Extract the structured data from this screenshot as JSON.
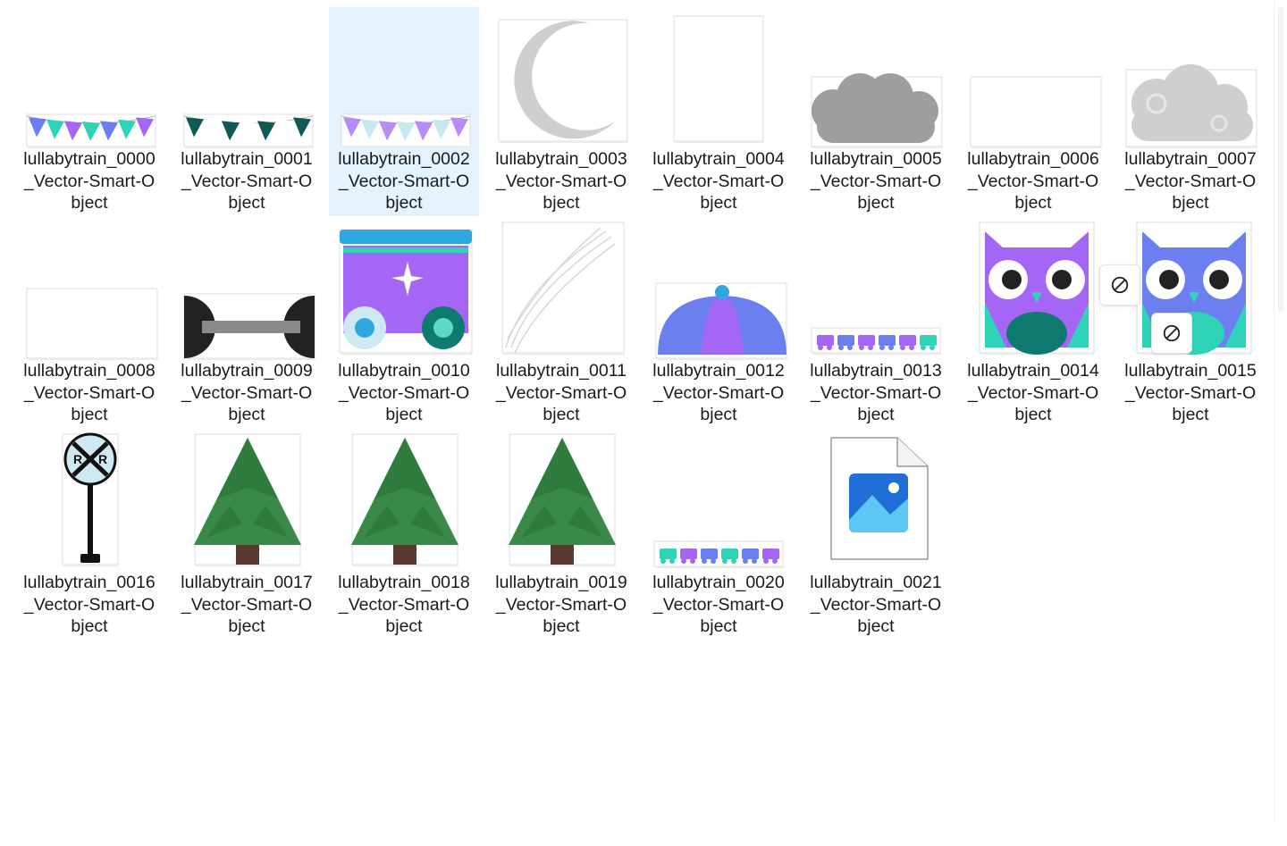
{
  "files": [
    {
      "name": "lullabytrain_0000_Vector-Smart-Object",
      "line1": "lullabytrain_0000",
      "line2": "_Vector-Smart-O",
      "line3": "bject",
      "thumb": "bunting-color-thumbnail",
      "selected": false
    },
    {
      "name": "lullabytrain_0001_Vector-Smart-Object",
      "line1": "lullabytrain_0001",
      "line2": "_Vector-Smart-O",
      "line3": "bject",
      "thumb": "bunting-dark-teal-thumbnail",
      "selected": false
    },
    {
      "name": "lullabytrain_0002_Vector-Smart-Object",
      "line1": "lullabytrain_0002",
      "line2": "_Vector-Smart-O",
      "line3": "bject",
      "thumb": "bunting-purple-thumbnail",
      "selected": true
    },
    {
      "name": "lullabytrain_0003_Vector-Smart-Object",
      "line1": "lullabytrain_0003",
      "line2": "_Vector-Smart-O",
      "line3": "bject",
      "thumb": "crescent-moon-thumbnail",
      "selected": false
    },
    {
      "name": "lullabytrain_0004_Vector-Smart-Object",
      "line1": "lullabytrain_0004",
      "line2": "_Vector-Smart-O",
      "line3": "bject",
      "thumb": "blank-portrait-thumbnail",
      "selected": false
    },
    {
      "name": "lullabytrain_0005_Vector-Smart-Object",
      "line1": "lullabytrain_0005",
      "line2": "_Vector-Smart-O",
      "line3": "bject",
      "thumb": "grey-cloud-thumbnail",
      "selected": false
    },
    {
      "name": "lullabytrain_0006_Vector-Smart-Object",
      "line1": "lullabytrain_0006",
      "line2": "_Vector-Smart-O",
      "line3": "bject",
      "thumb": "blank-landscape-thumbnail",
      "selected": false
    },
    {
      "name": "lullabytrain_0007_Vector-Smart-Object",
      "line1": "lullabytrain_0007",
      "line2": "_Vector-Smart-O",
      "line3": "bject",
      "thumb": "swirl-cloud-thumbnail",
      "selected": false
    },
    {
      "name": "lullabytrain_0008_Vector-Smart-Object",
      "line1": "lullabytrain_0008",
      "line2": "_Vector-Smart-O",
      "line3": "bject",
      "thumb": "blank-landscape-thumbnail",
      "selected": false
    },
    {
      "name": "lullabytrain_0009_Vector-Smart-Object",
      "line1": "lullabytrain_0009",
      "line2": "_Vector-Smart-O",
      "line3": "bject",
      "thumb": "axle-thumbnail",
      "selected": false
    },
    {
      "name": "lullabytrain_0010_Vector-Smart-Object",
      "line1": "lullabytrain_0010",
      "line2": "_Vector-Smart-O",
      "line3": "bject",
      "thumb": "train-car-thumbnail",
      "selected": false
    },
    {
      "name": "lullabytrain_0011_Vector-Smart-Object",
      "line1": "lullabytrain_0011",
      "line2": "_Vector-Smart-O",
      "line3": "bject",
      "thumb": "smoke-lines-thumbnail",
      "selected": false
    },
    {
      "name": "lullabytrain_0012_Vector-Smart-Object",
      "line1": "lullabytrain_0012",
      "line2": "_Vector-Smart-O",
      "line3": "bject",
      "thumb": "dome-thumbnail",
      "selected": false
    },
    {
      "name": "lullabytrain_0013_Vector-Smart-Object",
      "line1": "lullabytrain_0013",
      "line2": "_Vector-Smart-O",
      "line3": "bject",
      "thumb": "purple-train-thumbnail",
      "selected": false
    },
    {
      "name": "lullabytrain_0014_Vector-Smart-Object",
      "line1": "lullabytrain_0014",
      "line2": "_Vector-Smart-O",
      "line3": "bject",
      "thumb": "purple-owl-thumbnail",
      "selected": false
    },
    {
      "name": "lullabytrain_0015_Vector-Smart-Object",
      "line1": "lullabytrain_0015",
      "line2": "_Vector-Smart-O",
      "line3": "bject",
      "thumb": "blue-owl-thumbnail",
      "selected": false
    },
    {
      "name": "lullabytrain_0016_Vector-Smart-Object",
      "line1": "lullabytrain_0016",
      "line2": "_Vector-Smart-O",
      "line3": "bject",
      "thumb": "railroad-crossing-sign-thumbnail",
      "selected": false
    },
    {
      "name": "lullabytrain_0017_Vector-Smart-Object",
      "line1": "lullabytrain_0017",
      "line2": "_Vector-Smart-O",
      "line3": "bject",
      "thumb": "pine-tree-thumbnail",
      "selected": false
    },
    {
      "name": "lullabytrain_0018_Vector-Smart-Object",
      "line1": "lullabytrain_0018",
      "line2": "_Vector-Smart-O",
      "line3": "bject",
      "thumb": "pine-tree-thumbnail",
      "selected": false
    },
    {
      "name": "lullabytrain_0019_Vector-Smart-Object",
      "line1": "lullabytrain_0019",
      "line2": "_Vector-Smart-O",
      "line3": "bject",
      "thumb": "pine-tree-thumbnail",
      "selected": false
    },
    {
      "name": "lullabytrain_0020_Vector-Smart-Object",
      "line1": "lullabytrain_0020",
      "line2": "_Vector-Smart-O",
      "line3": "bject",
      "thumb": "teal-train-thumbnail",
      "selected": false
    },
    {
      "name": "lullabytrain_0021_Vector-Smart-Object",
      "line1": "lullabytrain_0021",
      "line2": "_Vector-Smart-O",
      "line3": "bject",
      "thumb": "image-file-icon",
      "selected": false
    }
  ],
  "overlays": [
    "blocked-icon",
    "blocked-icon"
  ],
  "colors": {
    "selection": "#e5f3ff",
    "purple": "#a566f5",
    "blue": "#6b7ff0",
    "teal": "#2fd4b8",
    "dark_teal": "#0f5a55",
    "cloud_grey": "#b8b8b8",
    "tree_green": "#3a8a47",
    "trunk": "#5a3a2e"
  }
}
